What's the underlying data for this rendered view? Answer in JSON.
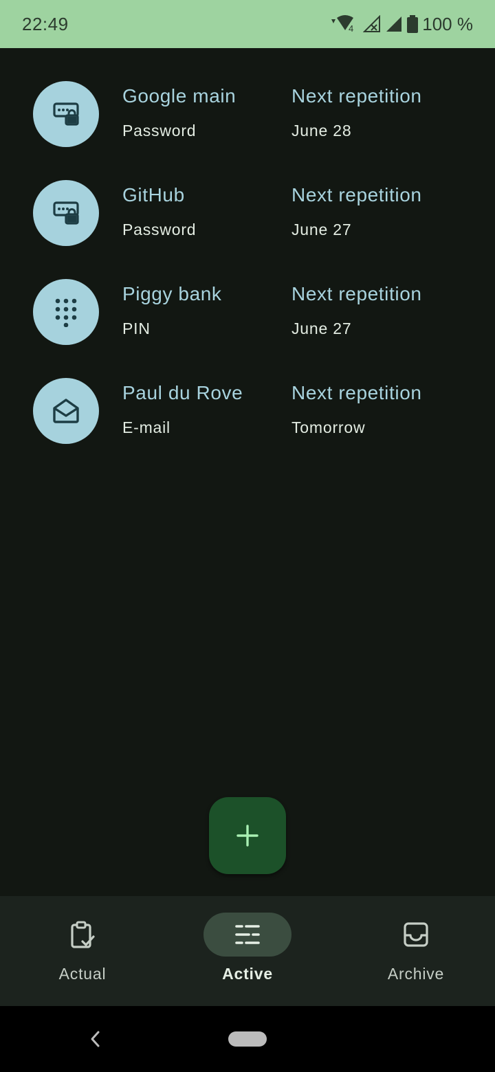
{
  "status_bar": {
    "time": "22:49",
    "battery": "100 %",
    "icons": [
      "wifi-icon",
      "network-4-icon",
      "signal-off-icon",
      "signal-icon",
      "battery-icon"
    ]
  },
  "items": [
    {
      "title": "Google main",
      "type": "Password",
      "next_label": "Next repetition",
      "next_date": "June 28",
      "icon": "password-lock-icon"
    },
    {
      "title": "GitHub",
      "type": "Password",
      "next_label": "Next repetition",
      "next_date": "June 27",
      "icon": "password-lock-icon"
    },
    {
      "title": "Piggy bank",
      "type": "PIN",
      "next_label": "Next repetition",
      "next_date": "June 27",
      "icon": "dialpad-icon"
    },
    {
      "title": "Paul du Rove",
      "type": "E-mail",
      "next_label": "Next repetition",
      "next_date": "Tomorrow",
      "icon": "email-icon"
    }
  ],
  "fab": {
    "icon": "plus-icon"
  },
  "bottom_nav": [
    {
      "label": "Actual",
      "icon": "clipboard-check-icon",
      "active": false
    },
    {
      "label": "Active",
      "icon": "list-icon",
      "active": true
    },
    {
      "label": "Archive",
      "icon": "inbox-icon",
      "active": false
    }
  ],
  "colors": {
    "status_bar": "#9ed3a0",
    "background": "#121712",
    "avatar": "#a6d2dd",
    "accent_text": "#a8d3de",
    "fab": "#1c5129",
    "nav_bg": "#1c231e",
    "nav_active": "#3b4d40"
  }
}
